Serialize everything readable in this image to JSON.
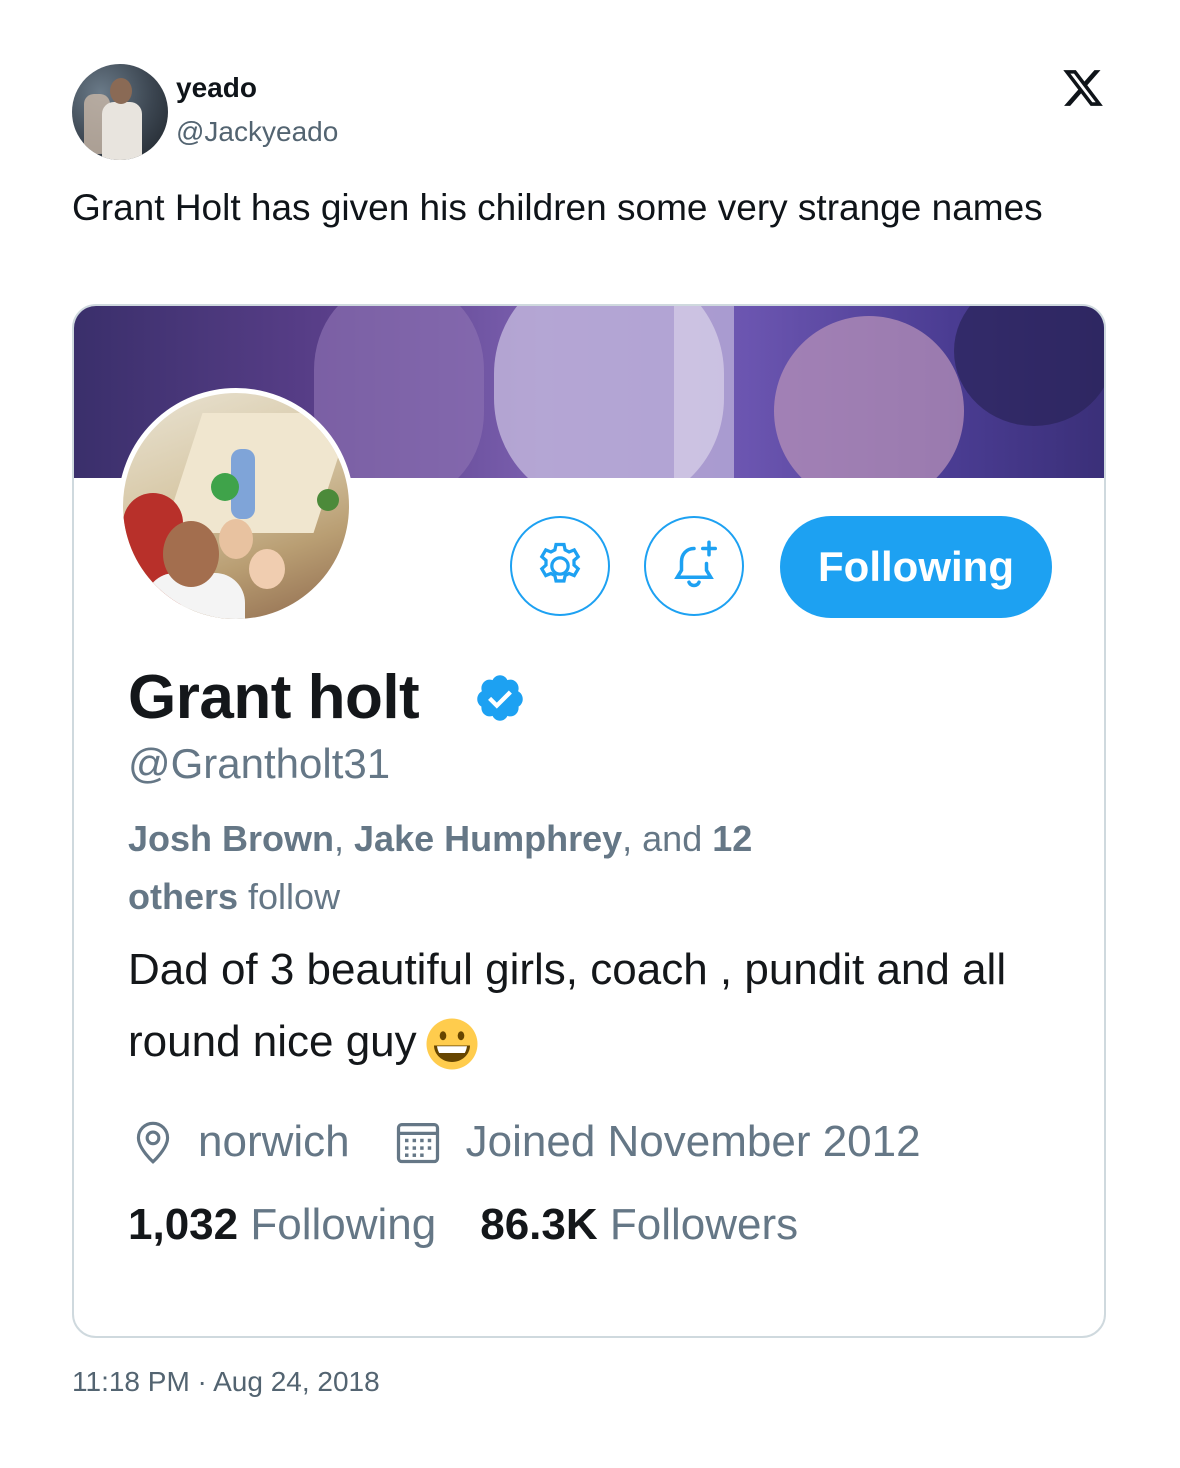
{
  "author": {
    "name": "yeado",
    "handle": "@Jackyeado"
  },
  "tweet": {
    "text": "Grant Holt has given his children  some very strange names",
    "timestamp": "11:18 PM · Aug 24, 2018"
  },
  "platform_logo": "x-logo-icon",
  "embedded_profile": {
    "buttons": {
      "settings_icon": "gear-icon",
      "notify_icon": "bell-plus-icon",
      "following_label": "Following"
    },
    "name": "Grant holt",
    "verified": true,
    "handle": "@Grantholt31",
    "followed_by": {
      "name1": "Josh Brown",
      "sep1": ", ",
      "name2": "Jake Humphrey",
      "sep2": ", and ",
      "count": "12",
      "others": "others",
      "follow": " follow"
    },
    "bio": "Dad of 3 beautiful girls, coach , pundit and all round nice guy",
    "bio_emoji": "grinning-face-emoji",
    "location": "norwich",
    "joined": "Joined November 2012",
    "following_count": "1,032",
    "following_label": "Following",
    "followers_count": "86.3K",
    "followers_label": "Followers",
    "accent_color": "#1da1f2"
  }
}
